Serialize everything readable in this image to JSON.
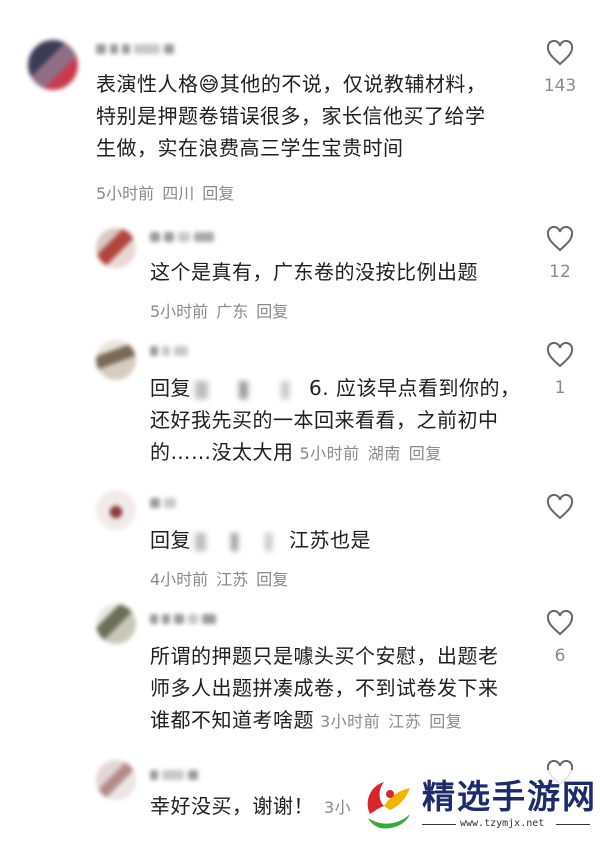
{
  "comments": [
    {
      "text_line1": "表演性人格",
      "emoji": "😅",
      "text_line1_rest": "其他的不说，仅说教辅材料，",
      "text_line2": "特别是押题卷错误很多，家长信他买了给学",
      "text_line3": "生做，实在浪费高三学生宝贵时间",
      "time": "5小时前",
      "location": "四川",
      "reply_label": "回复",
      "likes": "143"
    },
    {
      "text_line1": "这个是真有，广东卷的没按比例出题",
      "time": "5小时前",
      "location": "广东",
      "reply_label": "回复",
      "likes": "12"
    },
    {
      "reply_prefix": "回复",
      "reply_suffix": "6. 应该早点看到你的，",
      "text_line2": "还好我先买的一本回来看看，之前初中",
      "text_line3": "的……没太大用",
      "time": "5小时前",
      "location": "湖南",
      "reply_label": "回复",
      "likes": "1"
    },
    {
      "reply_prefix": "回复",
      "reply_suffix": "江苏也是",
      "time": "4小时前",
      "location": "江苏",
      "reply_label": "回复",
      "likes": ""
    },
    {
      "text_line1": "所谓的押题只是噱头买个安慰，出题老",
      "text_line2": "师多人出题拼凑成卷，不到试卷发下来",
      "text_line3": "谁都不知道考啥题",
      "time": "3小时前",
      "location": "江苏",
      "reply_label": "回复",
      "likes": "6"
    },
    {
      "text_line1": "幸好没买，谢谢！",
      "time": "3小"
    }
  ],
  "watermark": {
    "title": "精选手游网",
    "url": "www.tzymjx.net"
  },
  "colors": {
    "text": "#1f1f1f",
    "meta": "#8a8a8a",
    "watermark_title": "#1e2b6a",
    "watermark_logo_red": "#d8262b",
    "watermark_logo_green": "#3aa83a",
    "watermark_logo_yellow": "#f0b400"
  }
}
